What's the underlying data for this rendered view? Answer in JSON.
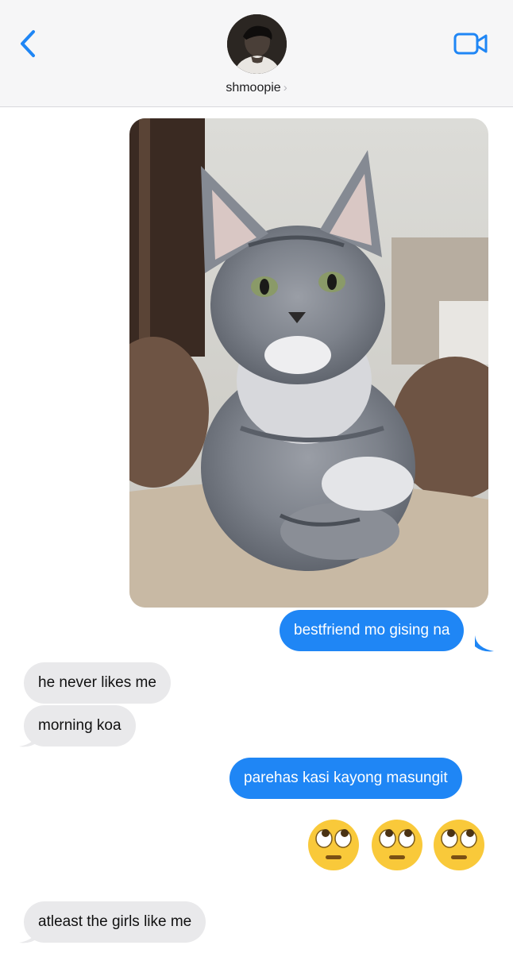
{
  "header": {
    "contact_name": "shmoopie",
    "chevron": "›",
    "back_icon": "chevron-left-icon",
    "video_icon": "video-camera-icon",
    "accent": "#1f86f5"
  },
  "conversation": {
    "photo": {
      "subject": "cat-photo"
    },
    "messages": [
      {
        "from": "me",
        "text": "bestfriend mo gising na"
      },
      {
        "from": "them",
        "text": "he never likes me"
      },
      {
        "from": "them",
        "text": "morning koa"
      },
      {
        "from": "me",
        "text": "parehas kasi kayong masungit"
      },
      {
        "from": "me",
        "emoji": [
          "🙄",
          "🙄",
          "🙄"
        ]
      },
      {
        "from": "them",
        "text": "atleast the girls like me"
      }
    ]
  },
  "colors": {
    "sent_bubble": "#1f86f5",
    "received_bubble": "#e9e9eb",
    "header_bg": "#f6f6f7"
  }
}
